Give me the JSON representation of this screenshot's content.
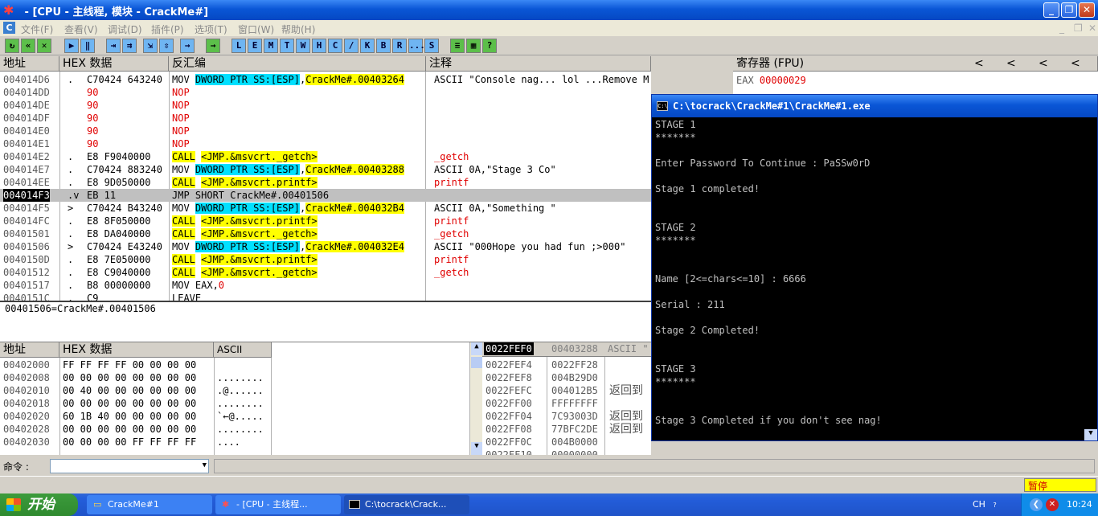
{
  "window": {
    "title": " - [CPU - 主线程, 模块 - CrackMe#]"
  },
  "menu": [
    "文件(F)",
    "查看(V)",
    "调试(D)",
    "插件(P)",
    "选项(T)",
    "窗口(W)",
    "帮助(H)"
  ],
  "toolbar_letters": [
    "L",
    "E",
    "M",
    "T",
    "W",
    "H",
    "C",
    "/",
    "K",
    "B",
    "R",
    "...",
    "S"
  ],
  "disasm": {
    "headers": {
      "addr": "地址",
      "hex": "HEX 数据",
      "dis": "反汇编",
      "comment": "注释"
    },
    "rows": [
      {
        "addr": "004014D6",
        "mk": ".",
        "hex": "C70424 643240",
        "dis": "MOV DWORD PTR SS:[ESP],CrackMe#.00403264",
        "cmt": "ASCII \"Console nag... lol ...Remove Me!0\""
      },
      {
        "addr": "004014DD",
        "mk": "",
        "hex": "90",
        "dis": "NOP",
        "cmt": ""
      },
      {
        "addr": "004014DE",
        "mk": "",
        "hex": "90",
        "dis": "NOP",
        "cmt": ""
      },
      {
        "addr": "004014DF",
        "mk": "",
        "hex": "90",
        "dis": "NOP",
        "cmt": ""
      },
      {
        "addr": "004014E0",
        "mk": "",
        "hex": "90",
        "dis": "NOP",
        "cmt": ""
      },
      {
        "addr": "004014E1",
        "mk": "",
        "hex": "90",
        "dis": "NOP",
        "cmt": ""
      },
      {
        "addr": "004014E2",
        "mk": ".",
        "hex": "E8 F9040000",
        "dis": "CALL <JMP.&msvcrt._getch>",
        "cmt": "_getch"
      },
      {
        "addr": "004014E7",
        "mk": ".",
        "hex": "C70424 883240",
        "dis": "MOV DWORD PTR SS:[ESP],CrackMe#.00403288",
        "cmt": "ASCII 0A,\"Stage 3 Co\""
      },
      {
        "addr": "004014EE",
        "mk": ".",
        "hex": "E8 9D050000",
        "dis": "CALL <JMP.&msvcrt.printf>",
        "cmt": "printf"
      },
      {
        "addr": "004014F3",
        "mk": ".v",
        "hex": "EB 11",
        "dis": "JMP SHORT CrackMe#.00401506",
        "cmt": ""
      },
      {
        "addr": "004014F5",
        "mk": ">",
        "hex": "C70424 B43240",
        "dis": "MOV DWORD PTR SS:[ESP],CrackMe#.004032B4",
        "cmt": "ASCII 0A,\"Something \""
      },
      {
        "addr": "004014FC",
        "mk": ".",
        "hex": "E8 8F050000",
        "dis": "CALL <JMP.&msvcrt.printf>",
        "cmt": "printf"
      },
      {
        "addr": "00401501",
        "mk": ".",
        "hex": "E8 DA040000",
        "dis": "CALL <JMP.&msvcrt._getch>",
        "cmt": "_getch"
      },
      {
        "addr": "00401506",
        "mk": ">",
        "hex": "C70424 E43240",
        "dis": "MOV DWORD PTR SS:[ESP],CrackMe#.004032E4",
        "cmt": "ASCII \"000Hope you had fun ;>000\""
      },
      {
        "addr": "0040150D",
        "mk": ".",
        "hex": "E8 7E050000",
        "dis": "CALL <JMP.&msvcrt.printf>",
        "cmt": "printf"
      },
      {
        "addr": "00401512",
        "mk": ".",
        "hex": "E8 C9040000",
        "dis": "CALL <JMP.&msvcrt._getch>",
        "cmt": "_getch"
      },
      {
        "addr": "00401517",
        "mk": ".",
        "hex": "B8 00000000",
        "dis": "MOV EAX,0",
        "cmt": ""
      },
      {
        "addr": "0040151C",
        "mk": ".",
        "hex": "C9",
        "dis": "LEAVE",
        "cmt": ""
      }
    ],
    "status": "00401506=CrackMe#.00401506"
  },
  "registers": {
    "title": "寄存器 (FPU)",
    "eax_label": "EAX",
    "eax": "00000029"
  },
  "dump": {
    "headers": {
      "addr": "地址",
      "hex": "HEX 数据",
      "ascii": "ASCII"
    },
    "rows": [
      {
        "addr": "00402000",
        "hex": "FF FF FF FF 00 00 00 00",
        "ascii": ""
      },
      {
        "addr": "00402008",
        "hex": "00 00 00 00 00 00 00 00",
        "ascii": "........"
      },
      {
        "addr": "00402010",
        "hex": "00 40 00 00 00 00 00 00",
        "ascii": ".@......"
      },
      {
        "addr": "00402018",
        "hex": "00 00 00 00 00 00 00 00",
        "ascii": "........"
      },
      {
        "addr": "00402020",
        "hex": "60 1B 40 00 00 00 00 00",
        "ascii": "`←@....."
      },
      {
        "addr": "00402028",
        "hex": "00 00 00 00 00 00 00 00",
        "ascii": "........"
      },
      {
        "addr": "00402030",
        "hex": "00 00 00 00 FF FF FF FF",
        "ascii": "...."
      }
    ]
  },
  "stack": {
    "top": "0022FEF0",
    "top_val": "00403288",
    "top_ascii": "ASCII \"",
    "rows": [
      {
        "addr": "0022FEF4",
        "val": "0022FF28",
        "cmt": ""
      },
      {
        "addr": "0022FEF8",
        "val": "004B29D0",
        "cmt": ""
      },
      {
        "addr": "0022FEFC",
        "val": "004012B5",
        "cmt": "返回到"
      },
      {
        "addr": "0022FF00",
        "val": "FFFFFFFF",
        "cmt": ""
      },
      {
        "addr": "0022FF04",
        "val": "7C93003D",
        "cmt": "返回到"
      },
      {
        "addr": "0022FF08",
        "val": "77BFC2DE",
        "cmt": "返回到"
      },
      {
        "addr": "0022FF0C",
        "val": "004B0000",
        "cmt": ""
      },
      {
        "addr": "0022FF10",
        "val": "00000000",
        "cmt": ""
      }
    ]
  },
  "console": {
    "title": "C:\\tocrack\\CrackMe#1\\CrackMe#1.exe",
    "lines": [
      "STAGE 1",
      "*******",
      "",
      "Enter Password To Continue : PaSSw0rD",
      "",
      "Stage 1 completed!",
      "",
      "",
      "STAGE 2",
      "*******",
      "",
      "",
      "Name [2<=chars<=10] : 6666",
      "",
      "Serial : 211",
      "",
      "Stage 2 Completed!",
      "",
      "",
      "STAGE 3",
      "*******",
      "",
      "",
      "Stage 3 Completed if you don't see nag!"
    ]
  },
  "command": {
    "label": "命令 :"
  },
  "status_right": "暂停",
  "taskbar": {
    "start": "开始",
    "tasks": [
      "CrackMe#1",
      " - [CPU - 主线程...",
      "C:\\tocrack\\Crack..."
    ],
    "lang": "CH",
    "time": "10:24"
  }
}
